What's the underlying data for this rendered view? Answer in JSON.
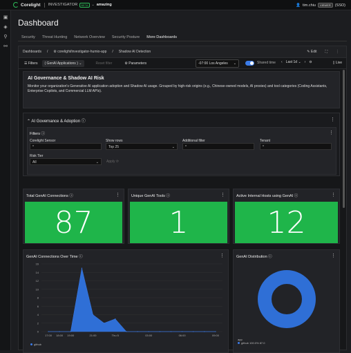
{
  "topbar": {
    "brand": "Corelight",
    "product": "INVESTIGATOR",
    "beta": "BETA",
    "tenant": "amazing",
    "user": "tim.chiu",
    "role": "VIEWER",
    "auth": "(SSO)"
  },
  "page": {
    "title": "Dashboard",
    "tabs": [
      "Security",
      "Threat Hunting",
      "Network Overview",
      "Security Posture",
      "More Dashboards"
    ],
    "active_tab": "More Dashboards"
  },
  "breadcrumb": {
    "items": [
      "Dashboards",
      "corelight/investigator-humio-app",
      "Shadow AI Detection"
    ],
    "edit": "Edit"
  },
  "filterbar": {
    "filters": "Filters",
    "chip": "( GenAI Applications )",
    "reset": "Reset filter",
    "parameters": "Parameters",
    "timezone": "-07:00 Los Angeles",
    "shared_time": "Shared time",
    "range": "Last 1d",
    "live": "Live"
  },
  "intro": {
    "title": "AI Governance & Shadow AI Risk",
    "text": "Monitor your organization's Generative AI application adoption and Shadow AI usage. Grouped by high-risk origins (e.g., Chinese-owned models, AI proxies) and tool categories (Coding Assistants, Enterprise Copilots, and Commercial LLM APIs)."
  },
  "section": {
    "title": "AI Governance & Adoption",
    "filters_title": "Filters",
    "fields": {
      "sensor_label": "Corelight Sensor",
      "sensor_value": "*",
      "rows_label": "Show rows",
      "rows_value": "Top 25",
      "additional_label": "Additional filter",
      "additional_value": "*",
      "tenant_label": "Tenant",
      "tenant_value": "*",
      "risk_label": "Risk Tier",
      "risk_value": "All",
      "apply": "Apply"
    }
  },
  "stats": [
    {
      "title": "Total GenAI Connections",
      "value": "87"
    },
    {
      "title": "Unique GenAI Tools",
      "value": "1"
    },
    {
      "title": "Active Internal Hosts using GenAI",
      "value": "12"
    }
  ],
  "panels": {
    "timeseries_title": "GenAI Connections Over Time",
    "distribution_title": "GenAI Distribution",
    "legend_series": "github",
    "pie_legend_title": "app",
    "pie_legend_text": "github 100.0% 87.0"
  },
  "chart_data": [
    {
      "type": "area",
      "title": "GenAI Connections Over Time",
      "x": [
        "17:00",
        "18:00",
        "19:00",
        "20:00",
        "21:00",
        "22:00",
        "Thu 5",
        "01:00",
        "02:00",
        "03:00",
        "04:00",
        "05:00",
        "06:00",
        "07:00",
        "08:00",
        "09:00"
      ],
      "y_ticks": [
        0,
        2,
        4,
        6,
        8,
        10,
        12,
        14,
        16
      ],
      "x_tick_labels": [
        "17:00",
        "18:00",
        "19:00",
        "21:00",
        "Thu 5",
        "03:00",
        "06:00",
        "09:00"
      ],
      "series": [
        {
          "name": "github",
          "values": [
            0,
            0,
            0,
            15,
            4,
            2,
            3,
            0,
            0,
            0,
            0,
            0,
            0,
            0,
            0,
            0
          ]
        }
      ],
      "ylim": [
        0,
        16
      ]
    },
    {
      "type": "pie",
      "title": "GenAI Distribution",
      "categories": [
        "github"
      ],
      "values": [
        87.0
      ]
    }
  ]
}
